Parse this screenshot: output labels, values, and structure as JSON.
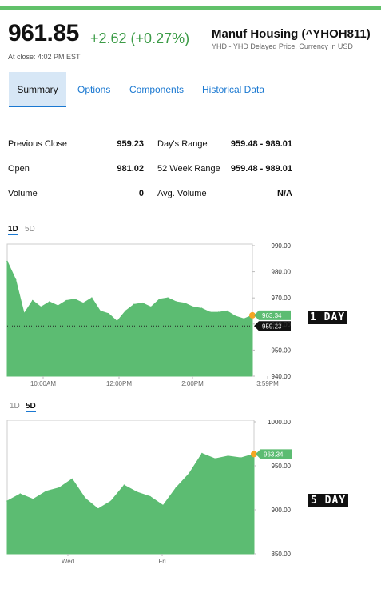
{
  "quote": {
    "price": "961.85",
    "change": "+2.62 (+0.27%)",
    "at_close": "At close: 4:02 PM EST",
    "name": "Manuf Housing (^YHOH811)",
    "subtitle": "YHD - YHD Delayed Price. Currency in USD"
  },
  "tabs": [
    {
      "label": "Summary",
      "active": true
    },
    {
      "label": "Options",
      "active": false
    },
    {
      "label": "Components",
      "active": false
    },
    {
      "label": "Historical Data",
      "active": false
    }
  ],
  "stats": {
    "previous_close": {
      "label": "Previous Close",
      "value": "959.23"
    },
    "open": {
      "label": "Open",
      "value": "981.02"
    },
    "volume": {
      "label": "Volume",
      "value": "0"
    },
    "days_range": {
      "label": "Day's Range",
      "value": "959.48 - 989.01"
    },
    "week52_range": {
      "label": "52 Week Range",
      "value": "959.48 - 989.01"
    },
    "avg_volume": {
      "label": "Avg. Volume",
      "value": "N/A"
    }
  },
  "chart1": {
    "tabs": [
      "1D",
      "5D"
    ],
    "active_tab": "1D",
    "stamp": "1 DAY",
    "current_badge": "963.34",
    "prev_close_badge": "959.23",
    "y_ticks": [
      "990.00",
      "980.00",
      "970.00",
      "960.00",
      "950.00",
      "940.00"
    ],
    "x_ticks": [
      "10:00AM",
      "12:00PM",
      "2:00PM",
      "3:59PM"
    ]
  },
  "chart2": {
    "tabs": [
      "1D",
      "5D"
    ],
    "active_tab": "5D",
    "stamp": "5 DAY",
    "current_badge": "963.34",
    "y_ticks": [
      "1000.00",
      "950.00",
      "900.00",
      "850.00"
    ],
    "x_ticks": [
      "Wed",
      "Fri"
    ]
  },
  "colors": {
    "up": "#3b9b46",
    "area": "#5cbc72",
    "accent": "#1a78d1",
    "marker": "#f5a623"
  },
  "chart_data": [
    {
      "type": "area",
      "title": "",
      "x": [
        "9:30",
        "9:35",
        "9:40",
        "9:45",
        "9:50",
        "10:00",
        "10:15",
        "10:30",
        "10:45",
        "11:00",
        "11:15",
        "11:30",
        "11:45",
        "12:00",
        "12:15",
        "12:30",
        "12:45",
        "13:00",
        "13:15",
        "13:30",
        "13:45",
        "14:00",
        "14:15",
        "14:30",
        "14:45",
        "15:00",
        "15:15",
        "15:30",
        "15:45",
        "15:59"
      ],
      "y": [
        984.0,
        977.0,
        964.0,
        969.0,
        966.5,
        968.5,
        967.0,
        969.0,
        969.5,
        968.0,
        970.0,
        965.0,
        964.0,
        961.0,
        965.0,
        967.5,
        968.0,
        966.5,
        969.5,
        970.0,
        968.5,
        968.0,
        966.5,
        966.0,
        964.5,
        964.5,
        965.0,
        963.0,
        962.0,
        963.34
      ],
      "previous_close": 959.23,
      "ylim": [
        940,
        990
      ]
    },
    {
      "type": "area",
      "title": "",
      "x": [
        "Mon 1",
        "Mon 2",
        "Mon 3",
        "Mon 4",
        "Tue 1",
        "Tue 2",
        "Tue 3",
        "Tue 4",
        "Wed 1",
        "Wed 2",
        "Wed 3",
        "Wed 4",
        "Thu 1",
        "Thu 2",
        "Thu 3",
        "Thu 4",
        "Fri 1",
        "Fri 2",
        "Fri 3",
        "Fri 4"
      ],
      "y": [
        910,
        918,
        912,
        921,
        925,
        935,
        913,
        901,
        910,
        928,
        920,
        915,
        905,
        925,
        941,
        964,
        958,
        961,
        959,
        963.34
      ],
      "ylim": [
        850,
        1000
      ]
    }
  ]
}
